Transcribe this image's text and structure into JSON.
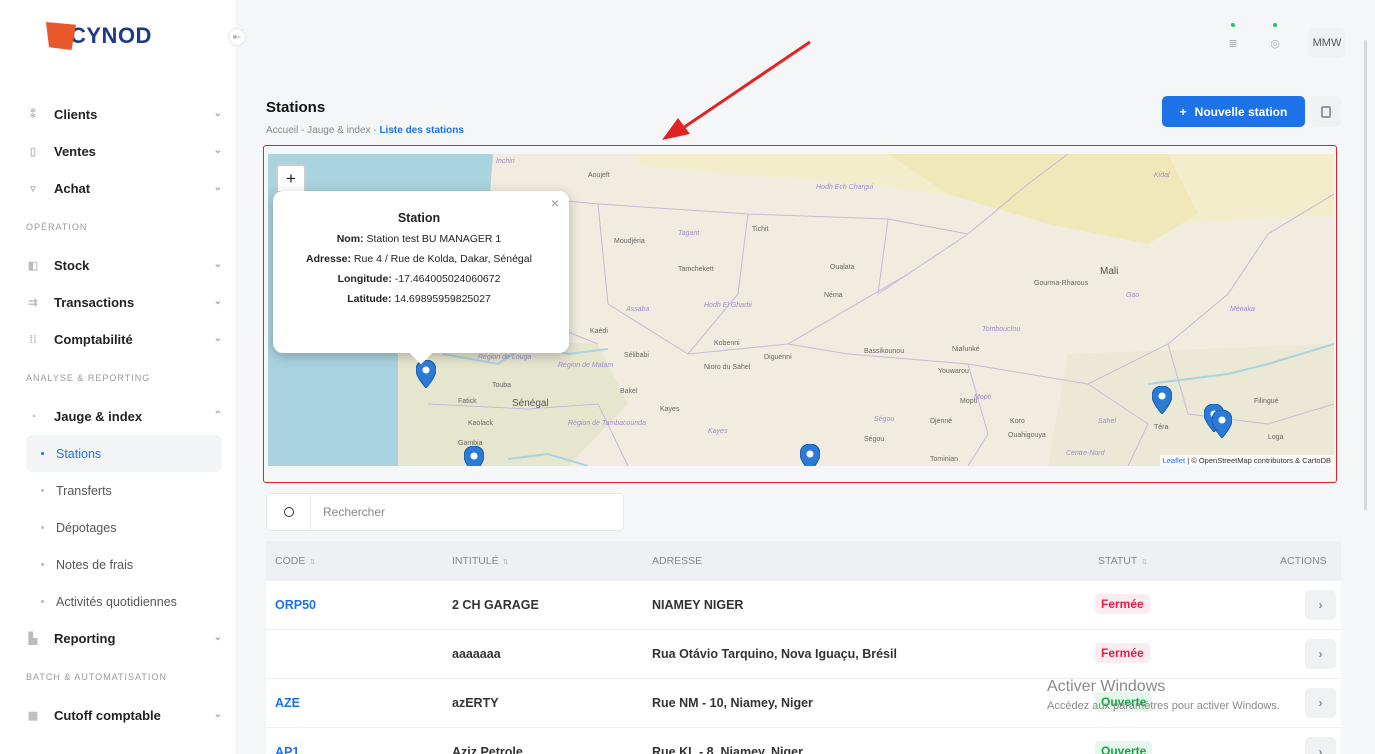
{
  "brand": {
    "logo_text": "CYNOD"
  },
  "topbar": {
    "user_initials": "MMW"
  },
  "sidebar": {
    "items": [
      {
        "label": "Clients"
      },
      {
        "label": "Ventes"
      },
      {
        "label": "Achat"
      }
    ],
    "section_operation": "OPÉRATION",
    "operation_items": [
      {
        "label": "Stock"
      },
      {
        "label": "Transactions"
      },
      {
        "label": "Comptabilité"
      }
    ],
    "section_analyse": "ANALYSE & REPORTING",
    "jauge": {
      "label": "Jauge & index"
    },
    "sub_items": [
      {
        "label": "Stations"
      },
      {
        "label": "Transferts"
      },
      {
        "label": "Dépotages"
      },
      {
        "label": "Notes de frais"
      },
      {
        "label": "Activités quotidiennes"
      }
    ],
    "reporting": {
      "label": "Reporting"
    },
    "section_batch": "BATCH & AUTOMATISATION",
    "cutoff": {
      "label": "Cutoff comptable"
    }
  },
  "header": {
    "title": "Stations",
    "breadcrumb_1": "Accueil",
    "breadcrumb_sep": "-",
    "breadcrumb_2": "Jauge & index",
    "breadcrumb_3": "Liste des stations",
    "new_button": "Nouvelle station"
  },
  "map": {
    "zoom_in": "+",
    "zoom_out": "−",
    "popup": {
      "title": "Station",
      "nom_label": "Nom:",
      "nom": "Station test BU MANAGER 1",
      "adresse_label": "Adresse:",
      "adresse": "Rue 4 / Rue de Kolda, Dakar, Sénégal",
      "longitude_label": "Longitude:",
      "longitude": "-17.464005024060672",
      "latitude_label": "Latitude:",
      "latitude": "14.69895959825027",
      "close": "×"
    },
    "attribution_leaflet": "Leaflet",
    "attribution_rest": "| © OpenStreetMap contributors & CartoDB",
    "labels": {
      "mali": "Mali",
      "senegal": "Sénégal",
      "touba": "Touba",
      "kaolack": "Kaolack",
      "fatick": "Fatick",
      "gambia": "Gambia",
      "kayes": "Kayes",
      "bakel": "Bakel",
      "kobenni": "Kobenni",
      "nioro": "Nioro du Sahel",
      "diguenni": "Diguenni",
      "nema": "Néma",
      "oualata": "Oualata",
      "tichit": "Tichit",
      "moudjeria": "Moudjéria",
      "tamchekett": "Tamchekett",
      "aoujeft": "Aoujeft",
      "kaedi": "Kaédi",
      "selibabi": "Sélibabi",
      "gourma": "Gourma-Rharous",
      "tombouctou": "Tombouctou",
      "niafunke": "Niafunké",
      "youwarou": "Youwarou",
      "bassikounou": "Bassikounou",
      "mopti": "Mopti",
      "djenne": "Djenné",
      "koro": "Koro",
      "ouahigouya": "Ouahigouya",
      "segou": "Ségou",
      "tominian": "Tominian",
      "tera": "Téra",
      "filingue": "Filingué",
      "loga": "Loga",
      "menaka": "Ménaka",
      "hodh_ech": "Hodh Ech Chargui",
      "hodh_el": "Hodh El Gharbi",
      "region_louga": "Région de Louga",
      "region_matam": "Région de Matam",
      "region_tamba": "Région de Tambacounda",
      "assaba": "Assaba",
      "tagant": "Tagant",
      "gao": "Gao",
      "kidal": "Kidal",
      "sahel": "Sahel",
      "centre_nord": "Centre-Nord",
      "mopti_reg": "Mopti",
      "segou_reg": "Ségou",
      "kayes_reg": "Kayes",
      "inchiri": "Inchiri"
    }
  },
  "search": {
    "placeholder": "Rechercher"
  },
  "table": {
    "columns": {
      "code": "CODE",
      "intitule": "INTITULÉ",
      "adresse": "ADRESSE",
      "statut": "STATUT",
      "actions": "ACTIONS"
    },
    "rows": [
      {
        "code": "ORP50",
        "intitule": "2 CH GARAGE",
        "adresse": "NIAMEY NIGER",
        "statut": "Fermée",
        "status_type": "closed"
      },
      {
        "code": "",
        "intitule": "aaaaaaa",
        "adresse": "Rua Otávio Tarquino, Nova Iguaçu, Brésil",
        "statut": "Fermée",
        "status_type": "closed"
      },
      {
        "code": "AZE",
        "intitule": "azERTY",
        "adresse": "Rue NM - 10, Niamey, Niger",
        "statut": "Ouverte",
        "status_type": "open"
      },
      {
        "code": "AP1",
        "intitule": "Aziz Petrole",
        "adresse": "Rue KL - 8, Niamey, Niger",
        "statut": "Ouverte",
        "status_type": "open"
      }
    ]
  },
  "watermark": {
    "line1": "Activer Windows",
    "line2": "Accédez aux paramètres pour activer Windows."
  },
  "colors": {
    "accent": "#1d72e8",
    "closed": "#e11d48",
    "open": "#16a34a",
    "annotation": "#e02424"
  }
}
